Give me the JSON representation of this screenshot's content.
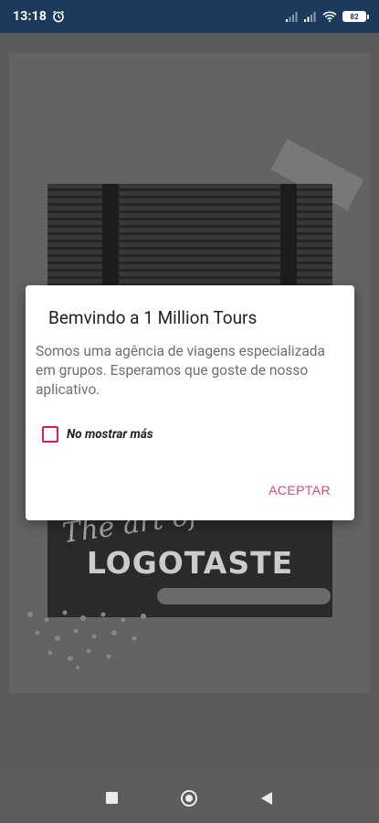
{
  "status_bar": {
    "time": "13:18",
    "battery": "82"
  },
  "background": {
    "script_text": "The art of",
    "logo_text": "LOGOTASTE"
  },
  "dialog": {
    "title": "Bemvindo a 1 Million Tours",
    "message": "Somos uma agência de viagens especializada em grupos. Esperamos que goste de nosso aplicativo.",
    "checkbox_label": "No mostrar más",
    "checkbox_checked": false,
    "accept_label": "ACEPTAR",
    "accent_color": "#d81b60"
  },
  "icons": {
    "alarm": "alarm-clock-icon",
    "signal": "cell-signal-icon",
    "wifi": "wifi-icon",
    "battery": "battery-icon",
    "recents": "recents-square-icon",
    "home": "home-circle-icon",
    "back": "back-triangle-icon"
  }
}
